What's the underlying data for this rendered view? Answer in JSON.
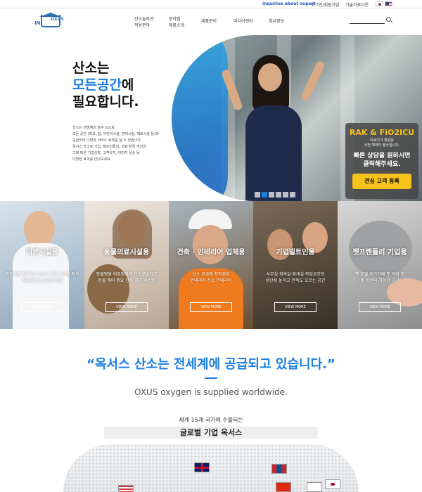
{
  "topbar": {
    "export_link": "inquiries about export",
    "login_link": "로그인/회원가입",
    "tech_link": "기술자료다운"
  },
  "nav": {
    "logo_text_in": "IN",
    "logo_text_oxus": "OXUS",
    "items": [
      "산소솔루션\n적용분야",
      "분야별\n제품소개",
      "제품문의",
      "미디어센터",
      "회사정보"
    ]
  },
  "hero": {
    "title_line1": "산소는",
    "title_accent": "모든공간",
    "title_line2_suffix": "에",
    "title_line3": "필요합니다.",
    "description": "산소는 생명체의 필수 요소로\n모든 공간 (학교, 집, 어린이시설, 반려시설, 재료시설 등)에\n공급되어 다양한 서비스 효과를 낼 수 있습니다.\n옥서스 산소로 기업, 헬프인들의, 의료 환경 개선과\n그에 따른 기업성장, 고객유치, 이미지 상승 등\n다양한 효과를 만나보세요.",
    "promo_title": "RAK & FiO2ICU",
    "promo_sub": "의료기기 특성상\n사전 예약이 필수입니다.",
    "promo_main": "빠른 상담을 원하시면\n클릭해주세요.",
    "promo_button": "관심 고객 등록",
    "slides": 6,
    "active_slide": 2
  },
  "categories": [
    {
      "title": "의료시설용",
      "desc": "의료기관 등에 실 고산소 공급 시스템 적용\n차세대 산소공급시스템",
      "more": "VIEW MORE"
    },
    {
      "title": "동물의료시설용",
      "desc": "동물병원 의료환경에 산소공급하고\n동물 케어 중요 산소 공급 시스템",
      "more": "VIEW MORE"
    },
    {
      "title": "건축 · 인테리어 업체용",
      "desc": "산소 공급에 최적화된\n인테리어 산소 인테리어",
      "more": "VIEW MORE"
    },
    {
      "title": "기업빌트인용",
      "desc": "사무실·회의실·휴게실·작업공간등\n생산성 높이고 만족도 오르는 공간",
      "more": "VIEW MORE"
    },
    {
      "title": "펫프렌들리 기업용",
      "desc": "펫 호텔·애견카페·펫 케어 등\n펫 동반이 가능한 공간",
      "more": "VIEW MORE"
    }
  ],
  "worldwide": {
    "title": "“옥서스 산소는 전세계에 공급되고 있습니다.”",
    "subtitle": "OXUS oxygen is supplied worldwide.",
    "count_line": "세계 15개 국가에 수출되는",
    "global_line": "글로벌 기업 옥서스"
  }
}
